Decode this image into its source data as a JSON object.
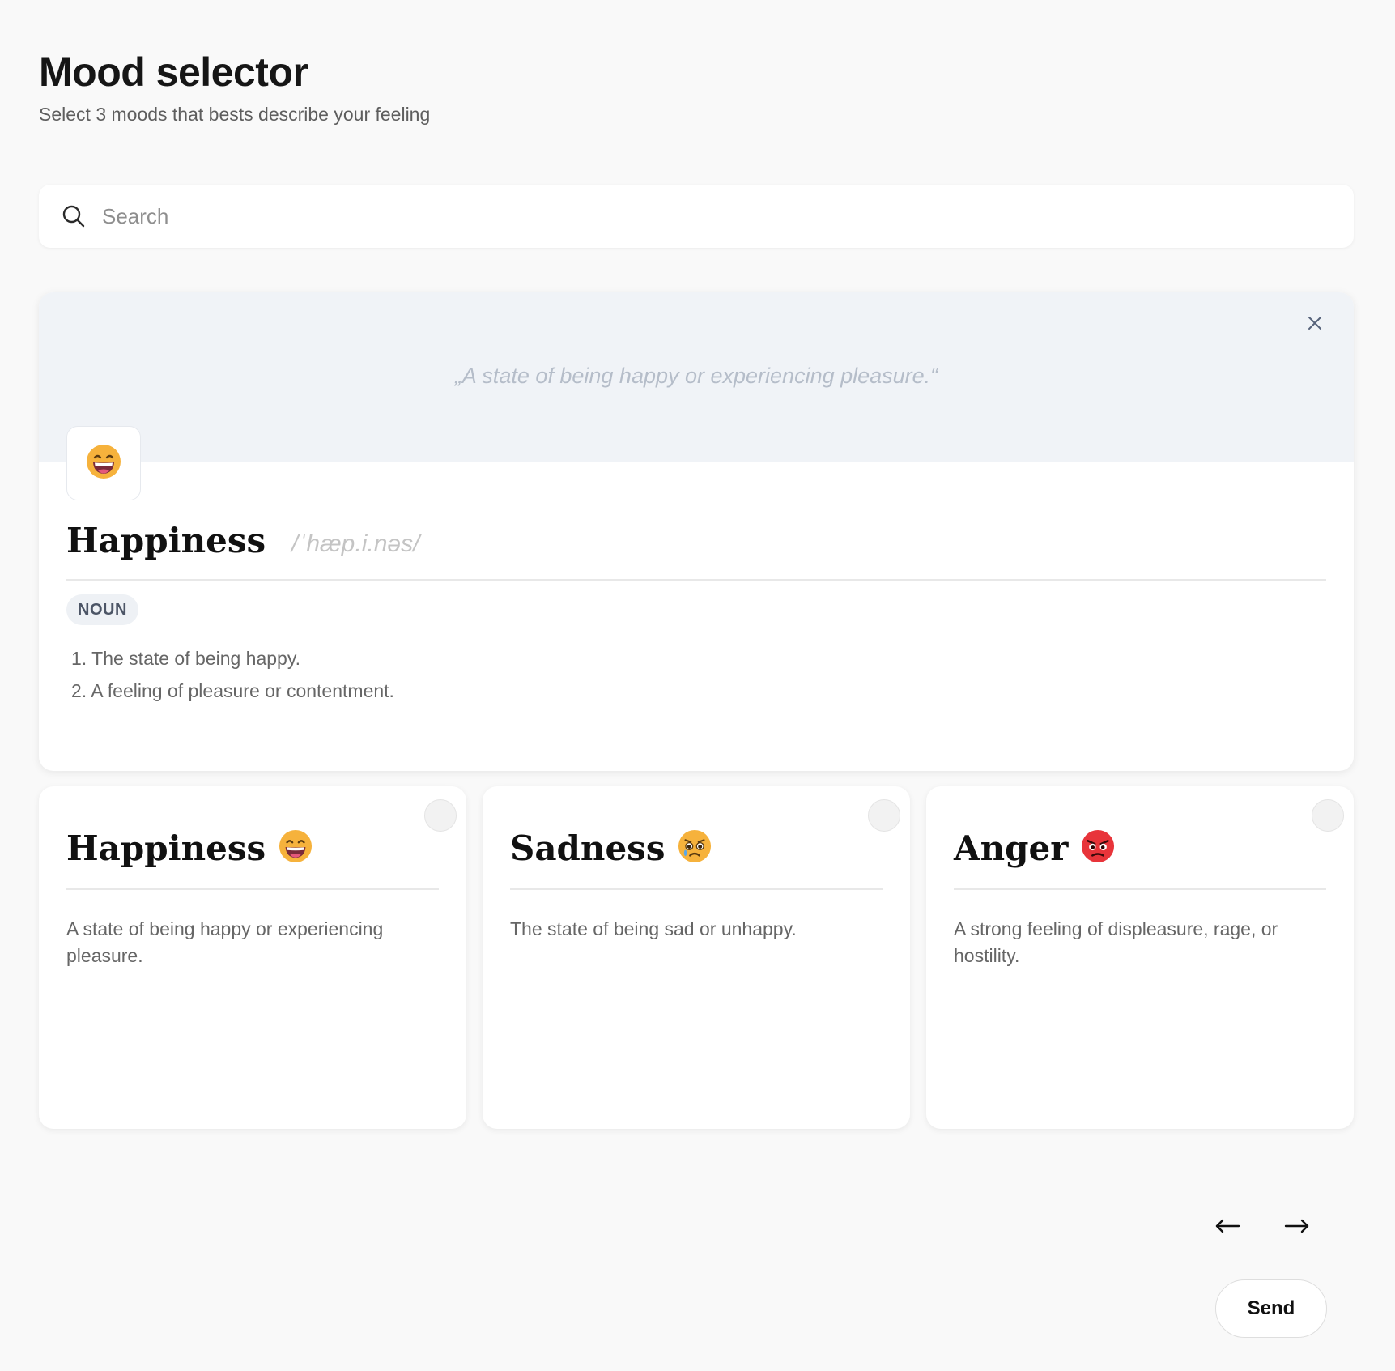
{
  "header": {
    "title": "Mood selector",
    "subtitle": "Select 3 moods that bests describe your feeling"
  },
  "search": {
    "placeholder": "Search",
    "icon": "search-icon"
  },
  "detail": {
    "quote": "„A state of being happy or experiencing pleasure.“",
    "emoji": "grinning-face-icon",
    "name": "Happiness",
    "phonetic": "/ˈhæp.i.nəs/",
    "part_of_speech": "NOUN",
    "definitions": [
      "1. The state of being happy.",
      "2. A feeling of pleasure or contentment."
    ],
    "close_icon": "close-icon"
  },
  "moods": [
    {
      "name": "Happiness",
      "emoji": "grinning-face-icon",
      "description": "A state of being happy or experiencing pleasure."
    },
    {
      "name": "Sadness",
      "emoji": "sad-face-icon",
      "description": "The state of being sad or unhappy."
    },
    {
      "name": "Anger",
      "emoji": "angry-face-icon",
      "description": "A strong feeling of displeasure, rage, or hostility."
    }
  ],
  "navigation": {
    "prev": "←",
    "next": "→"
  },
  "actions": {
    "send_label": "Send"
  },
  "colors": {
    "background": "#f9f9f9",
    "quote_band": "#f0f3f7",
    "emoji_yellow": "#f6b23c",
    "emoji_red": "#e8343a"
  }
}
